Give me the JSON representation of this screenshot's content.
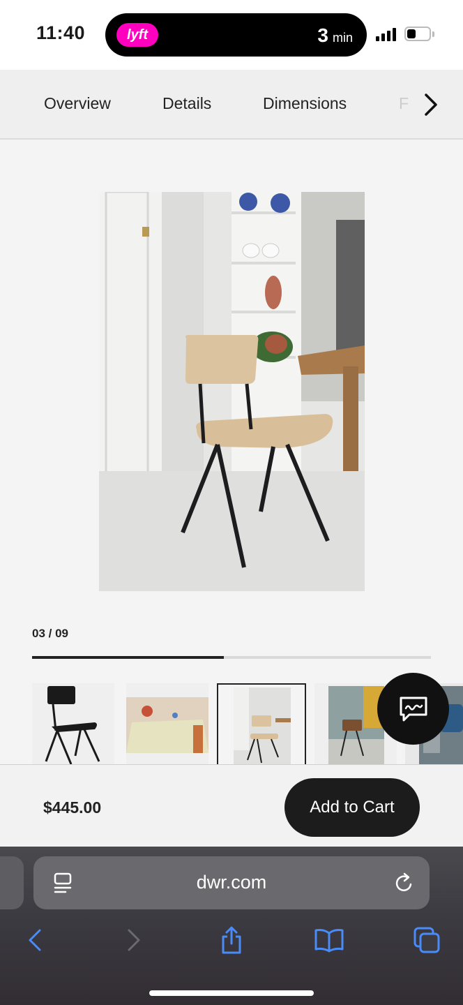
{
  "status_bar": {
    "time": "11:40",
    "live_activity": {
      "app_badge": "lyft",
      "eta_value": "3",
      "eta_unit": "min"
    }
  },
  "tab_nav": {
    "tabs": [
      "Overview",
      "Details",
      "Dimensions",
      "F"
    ],
    "next_icon": "chevron-right-icon"
  },
  "gallery": {
    "counter": "03 / 09",
    "current": 3,
    "total": 9,
    "progress_fraction": 0.48,
    "thumbnails": [
      {
        "name": "chair-black-studio"
      },
      {
        "name": "dining-table-scene"
      },
      {
        "name": "chair-natural-room",
        "selected": true
      },
      {
        "name": "chair-walnut-room"
      },
      {
        "name": "chair-blue-room"
      }
    ]
  },
  "chat": {
    "icon": "chat-bubble-icon"
  },
  "buy_bar": {
    "price": "$445.00",
    "add_to_cart_label": "Add to Cart"
  },
  "safari": {
    "url": "dwr.com",
    "toolbar": [
      "back-icon",
      "forward-icon",
      "share-icon",
      "bookmarks-icon",
      "tabs-icon"
    ]
  },
  "colors": {
    "lyft_pink": "#ff00bf",
    "safari_accent": "#4a8cf7",
    "button_dark": "#1c1c1c"
  }
}
